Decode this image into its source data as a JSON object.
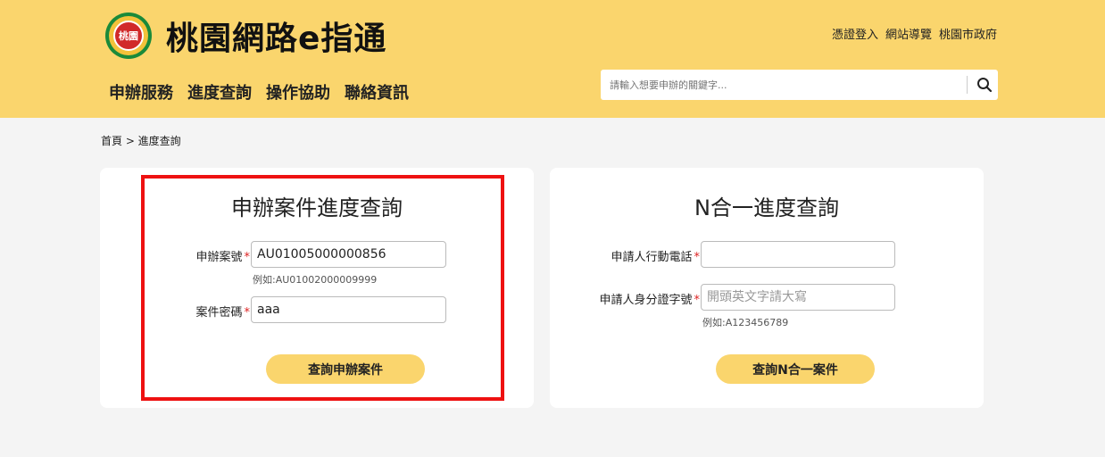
{
  "header": {
    "logo_text": "桃園",
    "site_title": "桃園網路e指通",
    "top_links": [
      "憑證登入",
      "網站導覽",
      "桃園市政府"
    ],
    "nav": [
      "申辦服務",
      "進度查詢",
      "操作協助",
      "聯絡資訊"
    ],
    "search": {
      "placeholder": "請輸入想要申辦的關鍵字...",
      "icon": "search-icon"
    }
  },
  "breadcrumb": "首頁 > 進度查詢",
  "left_card": {
    "title": "申辦案件進度查詢",
    "case_no": {
      "label": "申辦案號",
      "required": "*",
      "value": "AU01005000000856",
      "hint": "例如:AU01002000009999"
    },
    "password": {
      "label": "案件密碼",
      "required": "*",
      "value": "aaa"
    },
    "button": "查詢申辦案件"
  },
  "right_card": {
    "title": "N合一進度查詢",
    "phone": {
      "label": "申請人行動電話",
      "required": "*",
      "value": ""
    },
    "id_no": {
      "label": "申請人身分證字號",
      "required": "*",
      "placeholder": "開頭英文字請大寫",
      "hint": "例如:A123456789"
    },
    "button": "查詢N合一案件"
  },
  "colors": {
    "header_bg": "#fad56d",
    "highlight_border": "#e11111",
    "button_bg": "#fad56d"
  }
}
